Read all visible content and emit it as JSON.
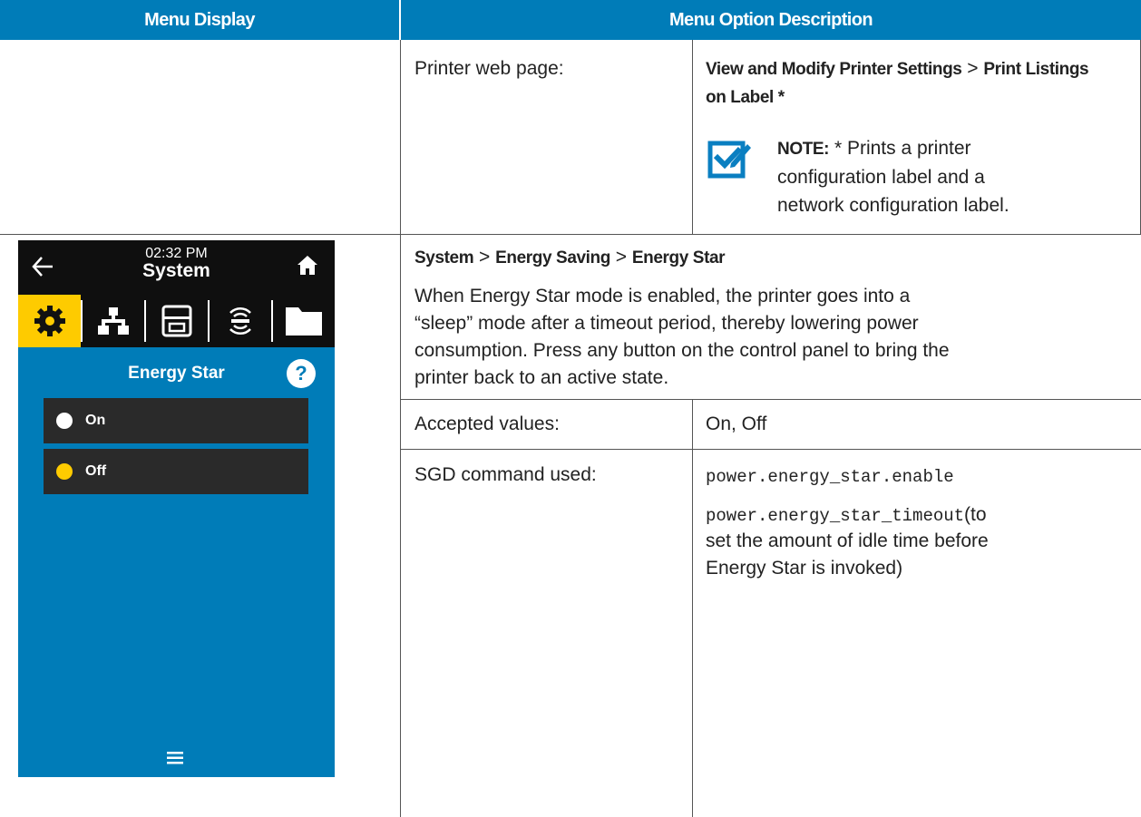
{
  "table_header": {
    "menu_display": "Menu Display",
    "menu_option_description": "Menu Option Description"
  },
  "row1": {
    "label": "Printer web page:",
    "path_part1": "View and Modify Printer Settings",
    "separator": ">",
    "path_part2_line1": "Print Listings",
    "path_part2_line2": "on Label *",
    "note_label": "NOTE:",
    "note_lines": [
      "* Prints a printer",
      "configuration label and a",
      "network configuration label."
    ]
  },
  "row2": {
    "path": {
      "seg1": "System",
      "sep1": ">",
      "seg2": "Energy Saving",
      "sep2": ">",
      "seg3": "Energy Star"
    },
    "description_lines": [
      "When Energy Star mode is enabled, the printer goes into a",
      "“sleep” mode after a timeout period, thereby lowering power",
      "consumption. Press any button on the control panel to bring the",
      "printer back to an active state."
    ],
    "accepted_label": "Accepted values:",
    "accepted_value": "On, Off",
    "sgd_label": "SGD command used:",
    "sgd_command1": "power.energy_star.enable",
    "sgd_command2": "power.energy_star_timeout",
    "sgd_command2_suffix": "(to",
    "sgd_note_lines": [
      "set the amount of idle time before",
      "Energy Star is invoked)"
    ]
  },
  "device_screen": {
    "time": "02:32 PM",
    "title": "System",
    "setting_title": "Energy Star",
    "help_symbol": "?",
    "options": [
      {
        "label": "On",
        "selected": false
      },
      {
        "label": "Off",
        "selected": true
      }
    ],
    "icons": {
      "back": "back-arrow-icon",
      "home": "home-icon",
      "tabs": [
        "gear-icon",
        "network-icon",
        "printer-icon",
        "wireless-icon",
        "folder-icon"
      ],
      "menu": "hamburger-menu-icon"
    },
    "colors": {
      "screen_blue": "#007cb8",
      "active_tab_yellow": "#fecb00",
      "dark_bar": "#0f0f0f",
      "option_bg": "#2a2a2a"
    }
  },
  "colors": {
    "header_blue": "#007cb8",
    "note_icon_blue": "#0a7fc1"
  }
}
